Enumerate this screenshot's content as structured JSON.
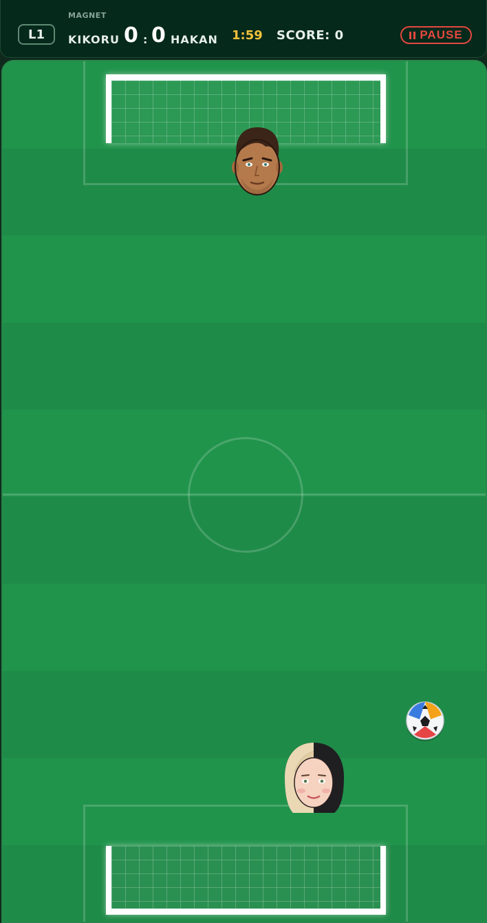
{
  "hud": {
    "level": "L1",
    "mode": "MAGNET",
    "team_left": "KIKORU",
    "team_right": "HAKAN",
    "score_left": "0",
    "score_right": "0",
    "separator": ":",
    "timer": "1:59",
    "score_label": "SCORE: 0",
    "pause_label": "PAUSE"
  },
  "colors": {
    "timer": "#f2c13b",
    "pause": "#e5483f",
    "pitch_light": "#21944c",
    "pitch_dark": "#1f8b48",
    "hud_bg": "#05291b"
  },
  "scene": {
    "opponent": "male-player-avatar",
    "player": "female-player-avatar",
    "ball": "soccer-ball"
  }
}
